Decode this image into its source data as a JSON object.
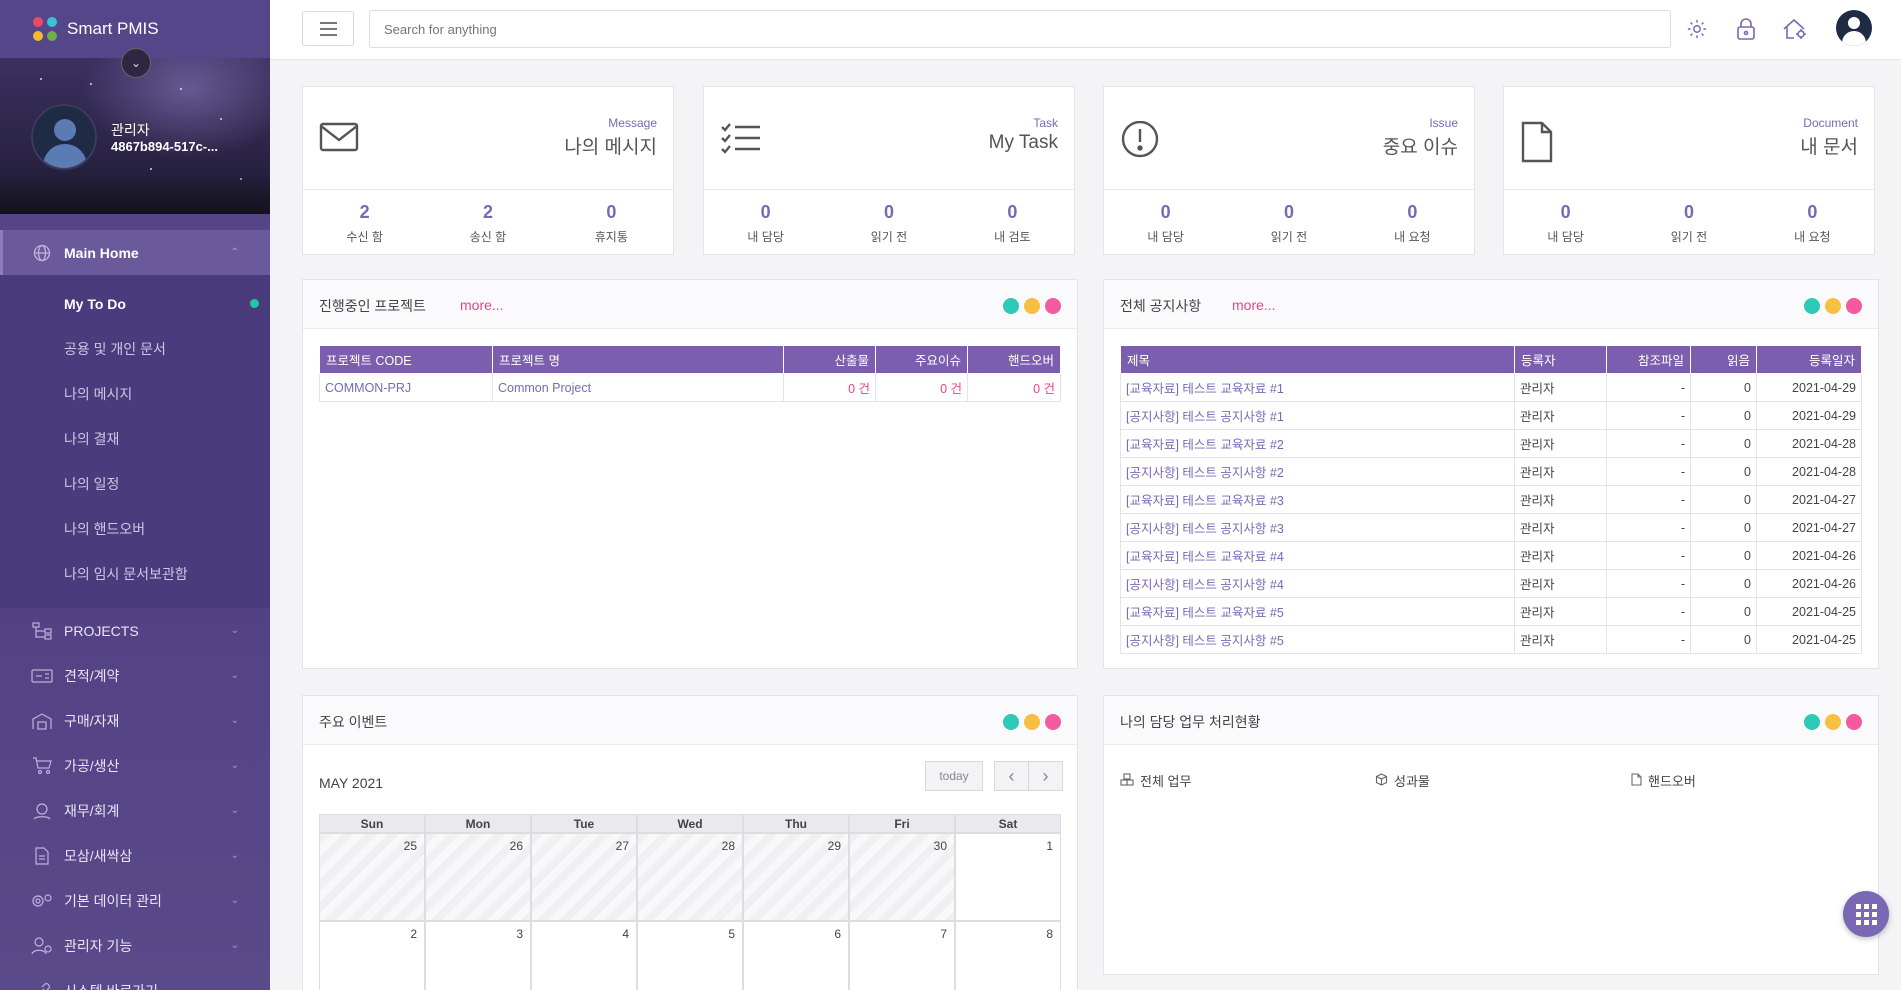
{
  "app": {
    "title": "Smart PMIS"
  },
  "user": {
    "name": "관리자",
    "id": "4867b894-517c-..."
  },
  "sidebar": {
    "main": {
      "label": "Main Home"
    },
    "sub_items": [
      {
        "label": "My To Do"
      },
      {
        "label": "공용 및 개인 문서"
      },
      {
        "label": "나의 메시지"
      },
      {
        "label": "나의 결재"
      },
      {
        "label": "나의 일정"
      },
      {
        "label": "나의 핸드오버"
      },
      {
        "label": "나의 임시 문서보관함"
      }
    ],
    "items": [
      {
        "label": "PROJECTS",
        "icon": "sitemap-icon"
      },
      {
        "label": "견적/계약",
        "icon": "contract-icon"
      },
      {
        "label": "구매/자재",
        "icon": "warehouse-icon"
      },
      {
        "label": "가공/생산",
        "icon": "cart-icon"
      },
      {
        "label": "재무/회계",
        "icon": "finance-icon"
      },
      {
        "label": "모삼/새싹삼",
        "icon": "document-icon"
      },
      {
        "label": "기본 데이터 관리",
        "icon": "gears-icon"
      },
      {
        "label": "관리자 기능",
        "icon": "users-cog-icon"
      },
      {
        "label": "시스템 바로가기",
        "icon": "link-icon"
      }
    ]
  },
  "search": {
    "placeholder": "Search for anything"
  },
  "stats": [
    {
      "en": "Message",
      "ko": "나의 메시지",
      "cols": [
        {
          "num": "2",
          "label": "수신 함"
        },
        {
          "num": "2",
          "label": "송신 함"
        },
        {
          "num": "0",
          "label": "휴지통"
        }
      ]
    },
    {
      "en": "Task",
      "ko": "My Task",
      "cols": [
        {
          "num": "0",
          "label": "내 담당"
        },
        {
          "num": "0",
          "label": "읽기 전"
        },
        {
          "num": "0",
          "label": "내 검토"
        }
      ]
    },
    {
      "en": "Issue",
      "ko": "중요 이슈",
      "cols": [
        {
          "num": "0",
          "label": "내 담당"
        },
        {
          "num": "0",
          "label": "읽기 전"
        },
        {
          "num": "0",
          "label": "내 요청"
        }
      ]
    },
    {
      "en": "Document",
      "ko": "내 문서",
      "cols": [
        {
          "num": "0",
          "label": "내 담당"
        },
        {
          "num": "0",
          "label": "읽기 전"
        },
        {
          "num": "0",
          "label": "내 요청"
        }
      ]
    }
  ],
  "projects": {
    "title": "진행중인 프로젝트",
    "more": "more...",
    "headers": [
      "프로젝트 CODE",
      "프로젝트 명",
      "산출물",
      "주요이슈",
      "핸드오버"
    ],
    "rows": [
      [
        "COMMON-PRJ",
        "Common Project",
        "0 건",
        "0 건",
        "0 건"
      ]
    ]
  },
  "notices": {
    "title": "전체 공지사항",
    "more": "more...",
    "headers": [
      "제목",
      "등록자",
      "참조파일",
      "읽음",
      "등록일자"
    ],
    "rows": [
      [
        "[교육자료] 테스트 교육자료 #1",
        "관리자",
        "-",
        "0",
        "2021-04-29"
      ],
      [
        "[공지사항] 테스트 공지사항 #1",
        "관리자",
        "-",
        "0",
        "2021-04-29"
      ],
      [
        "[교육자료] 테스트 교육자료 #2",
        "관리자",
        "-",
        "0",
        "2021-04-28"
      ],
      [
        "[공지사항] 테스트 공지사항 #2",
        "관리자",
        "-",
        "0",
        "2021-04-28"
      ],
      [
        "[교육자료] 테스트 교육자료 #3",
        "관리자",
        "-",
        "0",
        "2021-04-27"
      ],
      [
        "[공지사항] 테스트 공지사항 #3",
        "관리자",
        "-",
        "0",
        "2021-04-27"
      ],
      [
        "[교육자료] 테스트 교육자료 #4",
        "관리자",
        "-",
        "0",
        "2021-04-26"
      ],
      [
        "[공지사항] 테스트 공지사항 #4",
        "관리자",
        "-",
        "0",
        "2021-04-26"
      ],
      [
        "[교육자료] 테스트 교육자료 #5",
        "관리자",
        "-",
        "0",
        "2021-04-25"
      ],
      [
        "[공지사항] 테스트 공지사항 #5",
        "관리자",
        "-",
        "0",
        "2021-04-25"
      ]
    ]
  },
  "events": {
    "title": "주요 이벤트",
    "month": "MAY 2021",
    "today": "today",
    "prev": "‹",
    "next": "›",
    "dow": [
      "Sun",
      "Mon",
      "Tue",
      "Wed",
      "Thu",
      "Fri",
      "Sat"
    ],
    "weeks": [
      [
        "25",
        "26",
        "27",
        "28",
        "29",
        "30",
        "1"
      ],
      [
        "2",
        "3",
        "4",
        "5",
        "6",
        "7",
        "8"
      ]
    ]
  },
  "tasks": {
    "title": "나의 담당 업무 처리현황",
    "tabs": [
      {
        "label": "전체 업무",
        "icon": "cubes-icon"
      },
      {
        "label": "성과물",
        "icon": "cube-icon"
      },
      {
        "label": "핸드오버",
        "icon": "file-icon"
      }
    ]
  },
  "colors": {
    "accent": "#7a68b5",
    "sidebar": "#4f3f82",
    "table_head": "#7b5fae",
    "link_pink": "#e8458b",
    "todo_dot": "#1dc9a5"
  }
}
